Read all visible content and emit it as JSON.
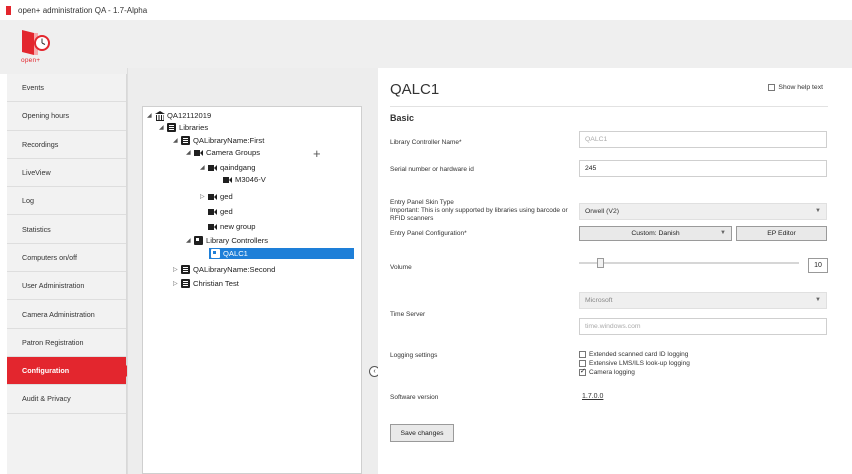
{
  "window": {
    "title": "open+ administration QA - 1.7-Alpha"
  },
  "brand": {
    "logo_text": "open+",
    "accent": "#e3262e"
  },
  "sidebar": {
    "items": [
      {
        "label": "Events"
      },
      {
        "label": "Opening hours"
      },
      {
        "label": "Recordings"
      },
      {
        "label": "LiveView"
      },
      {
        "label": "Log"
      },
      {
        "label": "Statistics"
      },
      {
        "label": "Computers on/off"
      },
      {
        "label": "User Administration"
      },
      {
        "label": "Camera Administration"
      },
      {
        "label": "Patron Registration"
      },
      {
        "label": "Configuration",
        "active": true
      },
      {
        "label": "Audit & Privacy"
      }
    ]
  },
  "tree": {
    "nodes": [
      {
        "label": "QA12112019",
        "icon": "building-icon",
        "expanded": true
      },
      {
        "label": "Libraries",
        "icon": "library-icon",
        "expanded": true
      },
      {
        "label": "QALibraryName:First",
        "icon": "library-icon",
        "expanded": true
      },
      {
        "label": "Camera Groups",
        "icon": "camera-group-icon",
        "expanded": true
      },
      {
        "label": "qaindgang",
        "icon": "camera-group-icon",
        "expanded": true
      },
      {
        "label": "M3046-V",
        "icon": "camera-icon"
      },
      {
        "label": "ged",
        "icon": "camera-group-icon",
        "expanded": false
      },
      {
        "label": "ged",
        "icon": "camera-group-icon"
      },
      {
        "label": "new group",
        "icon": "camera-group-icon"
      },
      {
        "label": "Library Controllers",
        "icon": "controller-icon",
        "expanded": true
      },
      {
        "label": "QALC1",
        "icon": "controller-icon",
        "selected": true
      },
      {
        "label": "QALibraryName:Second",
        "icon": "library-icon",
        "expanded": false
      },
      {
        "label": "Christian Test",
        "icon": "library-icon",
        "expanded": false
      }
    ],
    "add_symbol": "+",
    "selection_color": "#1e7fd8"
  },
  "detail": {
    "title": "QALC1",
    "help_label": "Show help text",
    "help_checked": false,
    "section": "Basic",
    "controller_name_label": "Library Controller Name*",
    "controller_name_value": "QALC1",
    "serial_label": "Serial number or hardware id",
    "serial_value": "245",
    "skin_label": "Entry Panel Skin Type",
    "skin_note": "Important: This is only supported by libraries using barcode or RFID scanners",
    "skin_value": "Orwell (V2)",
    "config_label": "Entry Panel Configuration*",
    "config_value": "Custom: Danish",
    "ep_editor_label": "EP Editor",
    "volume_label": "Volume",
    "volume_value": "10",
    "volume_level_fraction": 0.08,
    "time_server_label": "Time Server",
    "time_server_select": "Microsoft",
    "time_server_value": "time.windows.com",
    "logging_label": "Logging settings",
    "logging_options": [
      {
        "label": "Extended scanned card ID logging",
        "checked": false
      },
      {
        "label": "Extensive LMS/ILS look-up logging",
        "checked": false
      },
      {
        "label": "Camera logging",
        "checked": true
      }
    ],
    "software_label": "Software version",
    "software_value": "1.7.0.0",
    "save_label": "Save changes"
  }
}
